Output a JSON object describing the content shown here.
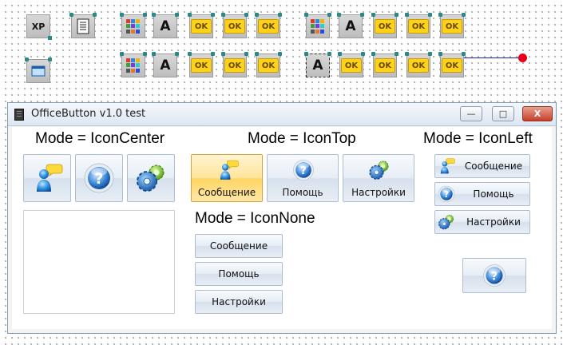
{
  "designer": {
    "xp_label": "XP",
    "ok_label": "OK",
    "a_label": "A"
  },
  "window": {
    "title": "OfficeButton v1.0 test",
    "minimize": "—",
    "maximize": "□",
    "close": "X"
  },
  "sections": {
    "icon_center": "Mode = IconCenter",
    "icon_top": "Mode = IconTop",
    "icon_left": "Mode = IconLeft",
    "icon_none": "Mode = IconNone"
  },
  "buttons": {
    "message": "Сообщение",
    "help": "Помощь",
    "settings": "Настройки"
  },
  "colors": {
    "accent_hot": "#ffd562",
    "wire": "#1a1aa0",
    "wire_end": "#e8001c",
    "connector": "#2c8a86"
  }
}
